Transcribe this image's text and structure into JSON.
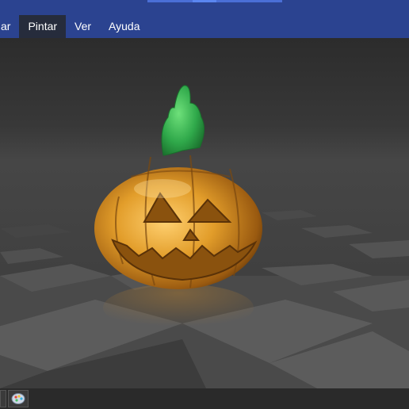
{
  "menu": {
    "items": [
      {
        "label": "ar",
        "active": false
      },
      {
        "label": "Pintar",
        "active": true
      },
      {
        "label": "Ver",
        "active": false
      },
      {
        "label": "Ayuda",
        "active": false
      }
    ]
  },
  "viewport": {
    "model": "pumpkin"
  },
  "taskbar": {
    "icons": [
      "window-button-icon",
      "paint-app-icon"
    ]
  },
  "colors": {
    "titlebar": "#2b4390",
    "active_menu": "#262c3c",
    "pumpkin_gold": "#e0a030",
    "stem_green": "#2fa84a"
  }
}
